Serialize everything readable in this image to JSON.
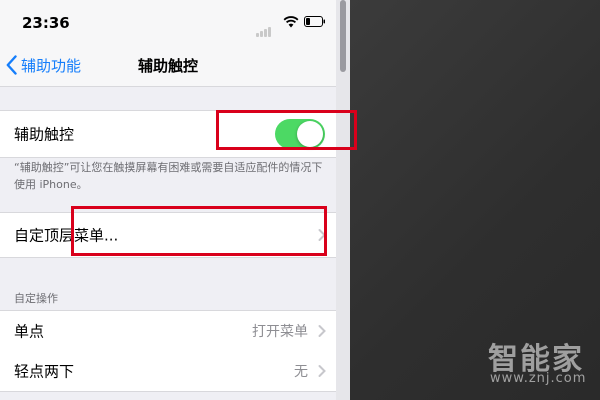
{
  "status_bar": {
    "time": "23:36"
  },
  "nav": {
    "back_label": "辅助功能",
    "title": "辅助触控"
  },
  "assistive_touch": {
    "label": "辅助触控",
    "toggle_on": true,
    "description": "“辅助触控”可让您在触摸屏幕有困难或需要自适应配件的情况下使用 iPhone。"
  },
  "customize_menu": {
    "label": "自定顶层菜单..."
  },
  "custom_actions": {
    "header": "自定操作",
    "rows": [
      {
        "label": "单点",
        "value": "打开菜单"
      },
      {
        "label": "轻点两下",
        "value": "无"
      }
    ]
  },
  "watermark": {
    "brand": "智能家",
    "url": "www.znj.com"
  },
  "colors": {
    "accent": "#157efb",
    "toggle_on": "#4cd964",
    "highlight": "#d9001b"
  }
}
